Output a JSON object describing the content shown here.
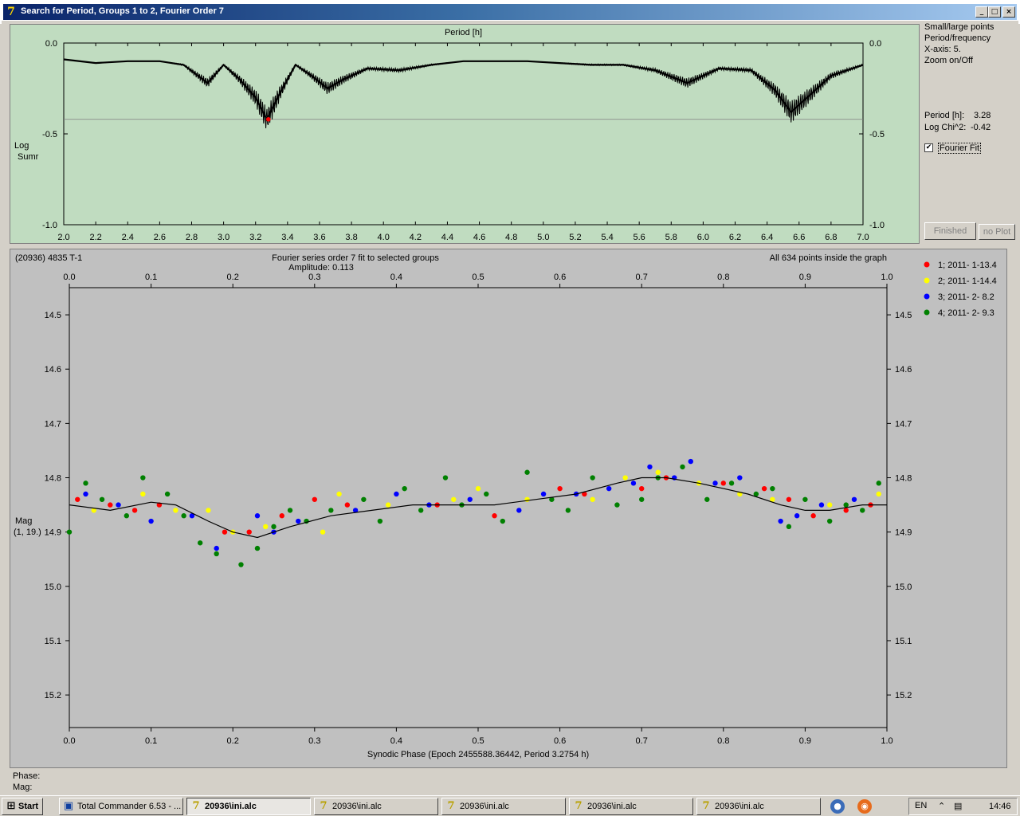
{
  "window": {
    "title": "Search for Period, Groups 1 to 2, Fourier Order 7",
    "icon": "ALCDEF-app-icon",
    "min_label": "_",
    "max_label": "□",
    "close_label": "×"
  },
  "periodogram": {
    "x_title": "Period [h]",
    "y_label_1": "Log",
    "y_label_2": "Sumr",
    "x_ticks": [
      "2.0",
      "2.2",
      "2.4",
      "2.6",
      "2.8",
      "3.0",
      "3.2",
      "3.4",
      "3.6",
      "3.8",
      "4.0",
      "4.2",
      "4.4",
      "4.6",
      "4.8",
      "5.0",
      "5.2",
      "5.4",
      "5.6",
      "5.8",
      "6.0",
      "6.2",
      "6.4",
      "6.6",
      "6.8",
      "7.0"
    ],
    "y_ticks": [
      "0.0",
      "-0.5",
      "-1.0"
    ],
    "colors": {
      "background": "#c0dcc0",
      "curve": "#000000",
      "marker": "#ff0000"
    }
  },
  "side_panel": {
    "lines": [
      "Small/large points",
      "Period/frequency",
      "X-axis: 5.",
      "Zoom on/Off"
    ],
    "period_label": "Period [h]:",
    "period_value": "3.28",
    "logchi_label": "Log Chi^2:",
    "logchi_value": "-0.42",
    "fourier_fit_label": "Fourier Fit",
    "fourier_fit_checked": true,
    "finished_button": "Finished",
    "noplot_button": "no Plot"
  },
  "lightcurve": {
    "object_label": "(20936) 4835 T-1",
    "title_line1": "Fourier series order 7 fit to selected groups",
    "title_line2": "Amplitude: 0.113",
    "points_note": "All 634 points inside the graph",
    "x_label": "Synodic Phase (Epoch 2455588.36442, Period 3.2754 h)",
    "y_label_1": "Mag",
    "y_label_2": "(1, 19.)",
    "x_ticks": [
      "0.0",
      "0.1",
      "0.2",
      "0.3",
      "0.4",
      "0.5",
      "0.6",
      "0.7",
      "0.8",
      "0.9",
      "1.0"
    ],
    "y_ticks": [
      "14.5",
      "14.6",
      "14.7",
      "14.8",
      "14.9",
      "15.0",
      "15.1",
      "15.2"
    ],
    "legend": [
      {
        "label": "1; 2011- 1-13.4",
        "color": "#ff0000"
      },
      {
        "label": "2; 2011- 1-14.4",
        "color": "#ffff00"
      },
      {
        "label": "3; 2011- 2- 8.2",
        "color": "#0000ff"
      },
      {
        "label": "4; 2011- 2- 9.3",
        "color": "#008000"
      }
    ],
    "colors": {
      "background": "#c0c0c0",
      "fit": "#000000"
    }
  },
  "status": {
    "phase_label": "Phase:",
    "mag_label": "Mag:"
  },
  "chart_data": [
    {
      "type": "line",
      "title": "",
      "xlabel": "Period [h]",
      "ylabel": "Log Sumr",
      "xlim": [
        2.0,
        7.0
      ],
      "ylim": [
        -1.0,
        0.0
      ],
      "grid": false,
      "x": [
        2.0,
        2.2,
        2.4,
        2.6,
        2.75,
        2.9,
        3.0,
        3.1,
        3.2,
        3.27,
        3.35,
        3.45,
        3.55,
        3.65,
        3.75,
        3.9,
        4.1,
        4.3,
        4.5,
        4.7,
        4.9,
        5.1,
        5.3,
        5.5,
        5.7,
        5.9,
        6.1,
        6.3,
        6.45,
        6.55,
        6.65,
        6.8,
        7.0
      ],
      "y": [
        -0.09,
        -0.11,
        -0.1,
        -0.1,
        -0.12,
        -0.22,
        -0.12,
        -0.2,
        -0.3,
        -0.42,
        -0.28,
        -0.12,
        -0.18,
        -0.25,
        -0.2,
        -0.14,
        -0.15,
        -0.12,
        -0.1,
        -0.1,
        -0.1,
        -0.11,
        -0.12,
        -0.12,
        -0.15,
        -0.22,
        -0.14,
        -0.15,
        -0.26,
        -0.38,
        -0.3,
        -0.18,
        -0.12
      ],
      "best_period": 3.28,
      "best_log_chi2": -0.42
    },
    {
      "type": "scatter",
      "title": "Fourier series order 7 fit to selected groups",
      "xlabel": "Synodic Phase (Epoch 2455588.36442, Period 3.2754 h)",
      "ylabel": "Mag",
      "xlim": [
        0.0,
        1.0
      ],
      "ylim": [
        15.26,
        14.45
      ],
      "grid": false,
      "fit": {
        "x": [
          0.0,
          0.05,
          0.1,
          0.13,
          0.17,
          0.2,
          0.23,
          0.27,
          0.32,
          0.37,
          0.42,
          0.47,
          0.52,
          0.57,
          0.62,
          0.67,
          0.7,
          0.73,
          0.77,
          0.8,
          0.83,
          0.87,
          0.9,
          0.93,
          0.97,
          1.0
        ],
        "y": [
          14.85,
          14.86,
          14.845,
          14.85,
          14.88,
          14.9,
          14.91,
          14.89,
          14.87,
          14.86,
          14.85,
          14.85,
          14.85,
          14.84,
          14.83,
          14.81,
          14.8,
          14.8,
          14.81,
          14.82,
          14.83,
          14.85,
          14.86,
          14.86,
          14.85,
          14.85
        ]
      },
      "series": [
        {
          "name": "1; 2011- 1-13.4",
          "x": [
            0.01,
            0.05,
            0.08,
            0.11,
            0.19,
            0.22,
            0.26,
            0.3,
            0.34,
            0.45,
            0.52,
            0.6,
            0.63,
            0.7,
            0.73,
            0.8,
            0.85,
            0.88,
            0.91,
            0.95,
            0.98
          ],
          "y": [
            14.84,
            14.85,
            14.86,
            14.85,
            14.9,
            14.9,
            14.87,
            14.84,
            14.85,
            14.85,
            14.87,
            14.82,
            14.83,
            14.82,
            14.8,
            14.81,
            14.82,
            14.84,
            14.87,
            14.86,
            14.85
          ]
        },
        {
          "name": "2; 2011- 1-14.4",
          "x": [
            0.03,
            0.09,
            0.13,
            0.17,
            0.2,
            0.24,
            0.31,
            0.33,
            0.39,
            0.47,
            0.5,
            0.56,
            0.64,
            0.68,
            0.72,
            0.77,
            0.82,
            0.86,
            0.93,
            0.99
          ],
          "y": [
            14.86,
            14.83,
            14.86,
            14.86,
            14.9,
            14.89,
            14.9,
            14.83,
            14.85,
            14.84,
            14.82,
            14.84,
            14.84,
            14.8,
            14.79,
            14.81,
            14.83,
            14.84,
            14.85,
            14.83
          ]
        },
        {
          "name": "3; 2011- 2- 8.2",
          "x": [
            0.02,
            0.06,
            0.1,
            0.15,
            0.18,
            0.23,
            0.25,
            0.28,
            0.35,
            0.4,
            0.44,
            0.49,
            0.55,
            0.58,
            0.62,
            0.66,
            0.69,
            0.71,
            0.74,
            0.76,
            0.79,
            0.82,
            0.87,
            0.89,
            0.92,
            0.96
          ],
          "y": [
            14.83,
            14.85,
            14.88,
            14.87,
            14.93,
            14.87,
            14.9,
            14.88,
            14.86,
            14.83,
            14.85,
            14.84,
            14.86,
            14.83,
            14.83,
            14.82,
            14.81,
            14.78,
            14.8,
            14.77,
            14.81,
            14.8,
            14.88,
            14.87,
            14.85,
            14.84
          ]
        },
        {
          "name": "4; 2011- 2- 9.3",
          "x": [
            0.0,
            0.02,
            0.04,
            0.07,
            0.09,
            0.12,
            0.14,
            0.16,
            0.18,
            0.21,
            0.23,
            0.25,
            0.27,
            0.29,
            0.32,
            0.36,
            0.38,
            0.41,
            0.43,
            0.46,
            0.48,
            0.51,
            0.53,
            0.56,
            0.59,
            0.61,
            0.64,
            0.67,
            0.7,
            0.72,
            0.75,
            0.78,
            0.81,
            0.84,
            0.86,
            0.88,
            0.9,
            0.93,
            0.95,
            0.97,
            0.99
          ],
          "y": [
            14.9,
            14.81,
            14.84,
            14.87,
            14.8,
            14.83,
            14.87,
            14.92,
            14.94,
            14.96,
            14.93,
            14.89,
            14.86,
            14.88,
            14.86,
            14.84,
            14.88,
            14.82,
            14.86,
            14.8,
            14.85,
            14.83,
            14.88,
            14.79,
            14.84,
            14.86,
            14.8,
            14.85,
            14.84,
            14.8,
            14.78,
            14.84,
            14.81,
            14.83,
            14.82,
            14.89,
            14.84,
            14.88,
            14.85,
            14.86,
            14.81
          ]
        }
      ]
    }
  ]
}
